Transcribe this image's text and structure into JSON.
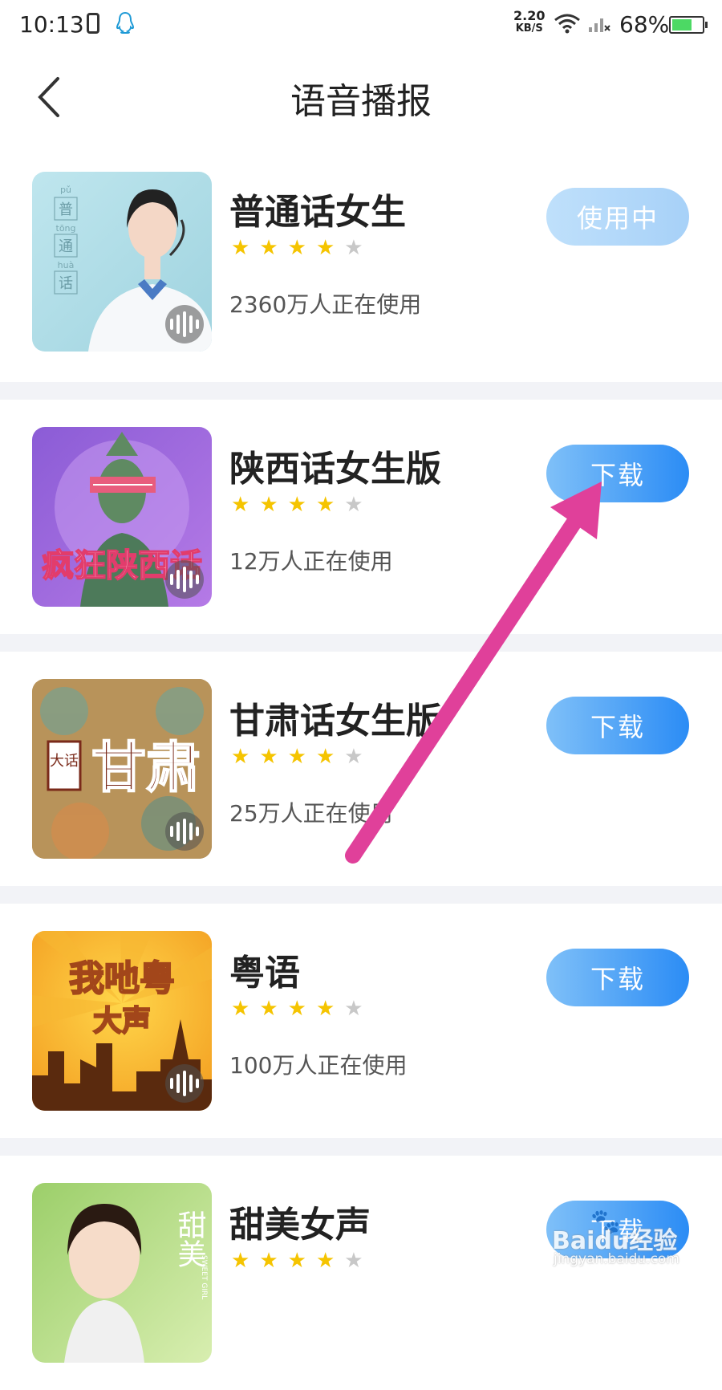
{
  "status": {
    "time": "10:13",
    "net_speed": "2.20",
    "net_unit": "KB/S",
    "battery": "68%",
    "battery_level": 0.68
  },
  "nav": {
    "title": "语音播报",
    "back_icon": "chevron-left-icon"
  },
  "items": [
    {
      "name": "普通话女生",
      "rating": 4,
      "users": "2360万人正在使用",
      "action": "使用中",
      "state": "in-use",
      "art": {
        "title_chars": [
          "普",
          "通",
          "话"
        ],
        "pinyin": [
          "pǔ",
          "tōng",
          "huà"
        ]
      }
    },
    {
      "name": "陕西话女生版",
      "rating": 4,
      "users": "12万人正在使用",
      "action": "下载",
      "state": "download",
      "art": {
        "title": "疯狂陕西话"
      }
    },
    {
      "name": "甘肃话女生版",
      "rating": 4,
      "users": "25万人正在使用",
      "action": "下载",
      "state": "download",
      "art": {
        "seal": "大话",
        "title": "甘肃"
      }
    },
    {
      "name": "粤语",
      "rating": 4,
      "users": "100万人正在使用",
      "action": "下载",
      "state": "download",
      "art": {
        "line1": "我吔粤",
        "line2": "大声"
      }
    },
    {
      "name": "甜美女声",
      "rating": 4,
      "users": "",
      "action": "下载",
      "state": "download",
      "art": {
        "title": "甜美",
        "sub": "SWEET GIRL"
      }
    }
  ],
  "watermark": {
    "brand": "Baidu经验",
    "url": "jingyan.baidu.com"
  },
  "colors": {
    "star_on": "#f5c400",
    "star_off": "#c8c8c8",
    "button": "#2b8cf5",
    "arrow": "#e0409a"
  }
}
